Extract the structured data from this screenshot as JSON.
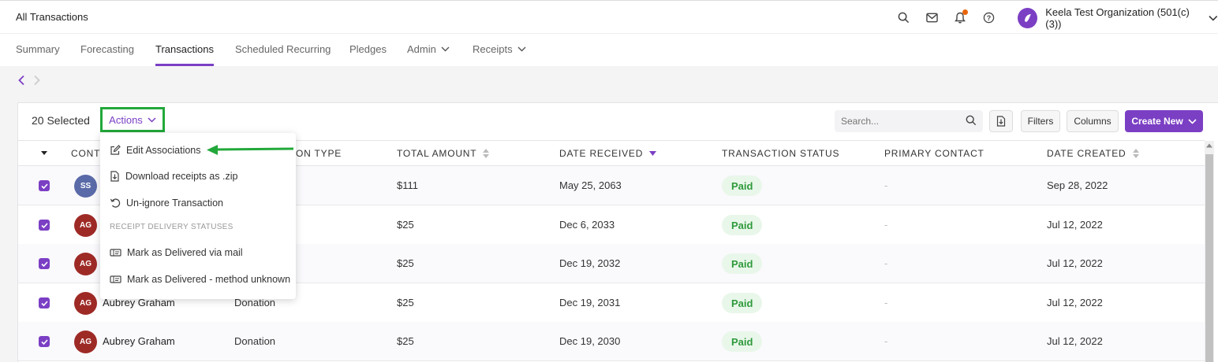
{
  "header": {
    "page_title": "All Transactions",
    "org_name": "Keela Test Organization (501(c)(3))",
    "icons": [
      "search-icon",
      "mail-icon",
      "bell-icon",
      "help-icon"
    ]
  },
  "nav": {
    "tabs": [
      {
        "label": "Summary",
        "active": false
      },
      {
        "label": "Forecasting",
        "active": false
      },
      {
        "label": "Transactions",
        "active": true
      },
      {
        "label": "Scheduled Recurring",
        "active": false
      },
      {
        "label": "Pledges",
        "active": false
      },
      {
        "label": "Admin",
        "active": false,
        "dropdown": true
      },
      {
        "label": "Receipts",
        "active": false,
        "dropdown": true
      }
    ]
  },
  "toolbar": {
    "selected_label": "20 Selected",
    "actions_label": "Actions",
    "search_placeholder": "Search...",
    "filters_label": "Filters",
    "columns_label": "Columns",
    "create_label": "Create New"
  },
  "table": {
    "headers": [
      "CONT",
      "ON TYPE",
      "TOTAL AMOUNT",
      "DATE RECEIVED",
      "TRANSACTION STATUS",
      "PRIMARY CONTACT",
      "DATE CREATED"
    ],
    "rows": [
      {
        "initials": "SS",
        "avatar_color": "#5a6aa8",
        "name": "",
        "type": "",
        "amount": "$111",
        "date_received": "May 25, 2063",
        "status": "Paid",
        "primary_contact": "-",
        "date_created": "Sep 28, 2022"
      },
      {
        "initials": "AG",
        "avatar_color": "#9e2a26",
        "name": "",
        "type": "",
        "amount": "$25",
        "date_received": "Dec 6, 2033",
        "status": "Paid",
        "primary_contact": "-",
        "date_created": "Jul 12, 2022"
      },
      {
        "initials": "AG",
        "avatar_color": "#9e2a26",
        "name": "",
        "type": "",
        "amount": "$25",
        "date_received": "Dec 19, 2032",
        "status": "Paid",
        "primary_contact": "-",
        "date_created": "Jul 12, 2022"
      },
      {
        "initials": "AG",
        "avatar_color": "#9e2a26",
        "name": "Aubrey Graham",
        "type": "Donation",
        "amount": "$25",
        "date_received": "Dec 19, 2031",
        "status": "Paid",
        "primary_contact": "-",
        "date_created": "Jul 12, 2022"
      },
      {
        "initials": "AG",
        "avatar_color": "#9e2a26",
        "name": "Aubrey Graham",
        "type": "Donation",
        "amount": "$25",
        "date_received": "Dec 19, 2030",
        "status": "Paid",
        "primary_contact": "-",
        "date_created": "Jul 12, 2022"
      }
    ]
  },
  "actions_menu": {
    "items": [
      {
        "label": "Edit Associations",
        "icon": "edit-icon"
      },
      {
        "label": "Download receipts as .zip",
        "icon": "download-icon"
      },
      {
        "label": "Un-ignore Transaction",
        "icon": "undo-icon"
      }
    ],
    "section_label": "RECEIPT DELIVERY STATUSES",
    "delivery_items": [
      {
        "label": "Mark as Delivered via mail",
        "icon": "ticket-icon"
      },
      {
        "label": "Mark as Delivered - method unknown",
        "icon": "ticket-icon"
      }
    ]
  },
  "colors": {
    "accent": "#7b3fc4",
    "highlight": "#22a83a",
    "paid_text": "#2f9a3c",
    "paid_bg": "#e9f7ea"
  }
}
